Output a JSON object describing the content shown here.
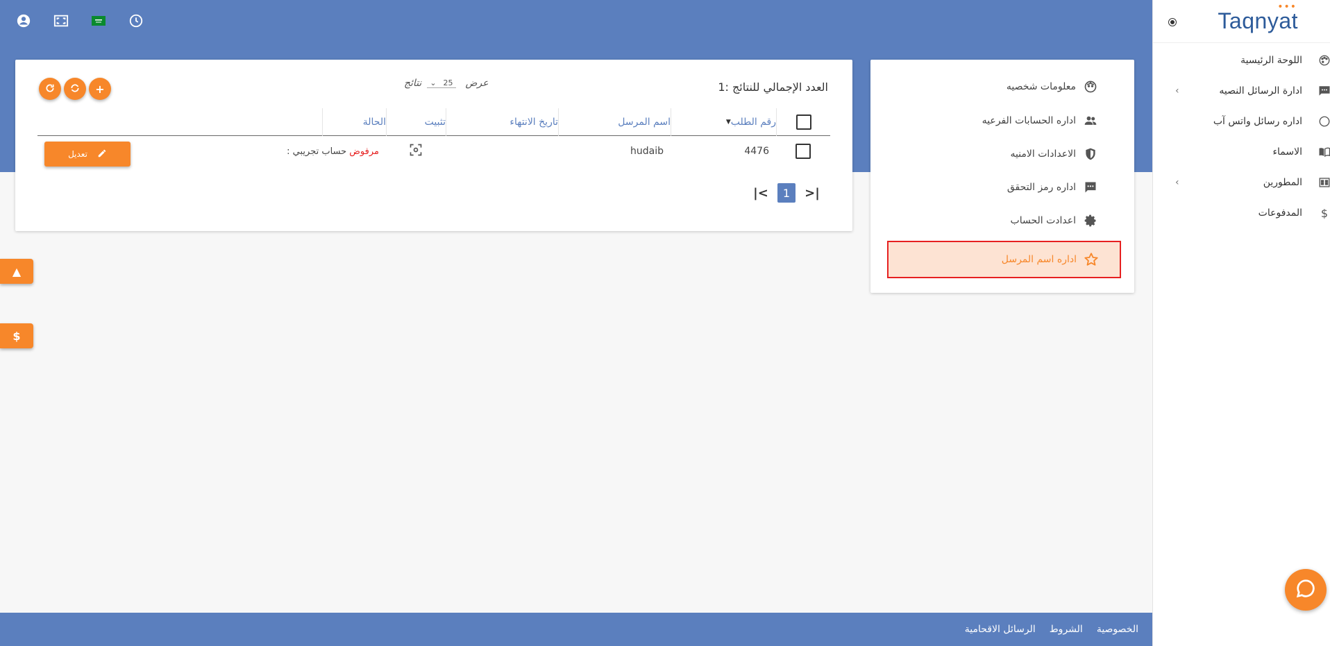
{
  "brand": {
    "logo": "Taqnyat",
    "dots": "•••"
  },
  "topbar_icons": [
    "account-circle-icon",
    "fullscreen-icon",
    "saudi-flag-icon",
    "clock-icon"
  ],
  "sidebar": {
    "items": [
      {
        "label": "اللوحة الرئيسية",
        "icon": "palette-icon",
        "chevron": false
      },
      {
        "label": "ادارة الرسائل النصيه",
        "icon": "sms-icon",
        "chevron": true
      },
      {
        "label": "اداره رسائل واتس آب",
        "icon": "whatsapp-icon",
        "chevron": false
      },
      {
        "label": "الاسماء",
        "icon": "book-icon",
        "chevron": false
      },
      {
        "label": "المطورين",
        "icon": "developer-icon",
        "chevron": true
      },
      {
        "label": "المدفوعات",
        "icon": "dollar-icon",
        "chevron": false
      }
    ]
  },
  "settings_menu": {
    "items": [
      {
        "label": "معلومات شخصيه",
        "icon": "face-icon"
      },
      {
        "label": "اداره الحسابات الفرعيه",
        "icon": "group-icon"
      },
      {
        "label": "الاعدادات الامنيه",
        "icon": "shield-icon"
      },
      {
        "label": "اداره رمز التحقق",
        "icon": "message-icon"
      },
      {
        "label": "اعدادت الحساب",
        "icon": "gear-icon"
      },
      {
        "label": "اداره اسم المرسل",
        "icon": "star-icon",
        "active": true
      }
    ]
  },
  "table": {
    "total_label": "العدد الإجمالي للنتائج :1",
    "show_label": "عرض",
    "per_page": "25",
    "results_label": "نتائج",
    "headers": {
      "request_no": "رقم الطلب",
      "sender_name": "اسم المرسل",
      "expiry_date": "تاريخ الانتهاء",
      "pin": "تثبيت",
      "status": "الحالة"
    },
    "rows": [
      {
        "request_no": "4476",
        "sender_name": "hudaib",
        "expiry_date": "",
        "status_rejected": "مرفوض",
        "status_detail": ": حساب تجريبي",
        "edit_label": "تعديل"
      }
    ],
    "pagination": {
      "current_page": "1"
    }
  },
  "footer": {
    "links": [
      "الخصوصية",
      "الشروط",
      "الرسائل الاقحامية"
    ]
  },
  "colors": {
    "primary_blue": "#5b7fbe",
    "accent_orange": "#f7872a",
    "rejected_red": "#e62020",
    "active_bg": "#fde3d3"
  }
}
